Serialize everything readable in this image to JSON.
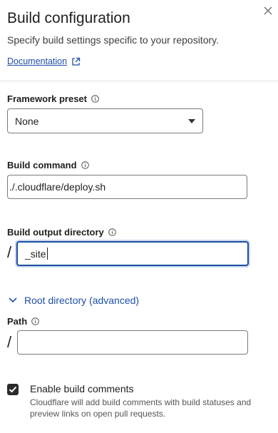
{
  "header": {
    "title": "Build configuration",
    "subtitle": "Specify build settings specific to your repository.",
    "doc_link": "Documentation"
  },
  "icons": {
    "close": "close-icon",
    "external": "external-link-icon",
    "info": "info-icon",
    "dropdown": "triangle-down-icon",
    "chevron": "chevron-down-icon",
    "check": "check-icon"
  },
  "framework": {
    "label": "Framework preset",
    "value": "None"
  },
  "build_command": {
    "label": "Build command",
    "value": "./.cloudflare/deploy.sh"
  },
  "output_dir": {
    "label": "Build output directory",
    "prefix": "/",
    "value": "_site"
  },
  "root": {
    "toggle_label": "Root directory (advanced)",
    "path_label": "Path",
    "prefix": "/",
    "value": ""
  },
  "comments": {
    "checked": true,
    "label": "Enable build comments",
    "description": "Cloudflare will add build comments with build statuses and preview links on open pull requests."
  },
  "colors": {
    "link": "#1d4fa8",
    "focus_border": "#1b4fa0",
    "text": "#1f1f1f"
  }
}
